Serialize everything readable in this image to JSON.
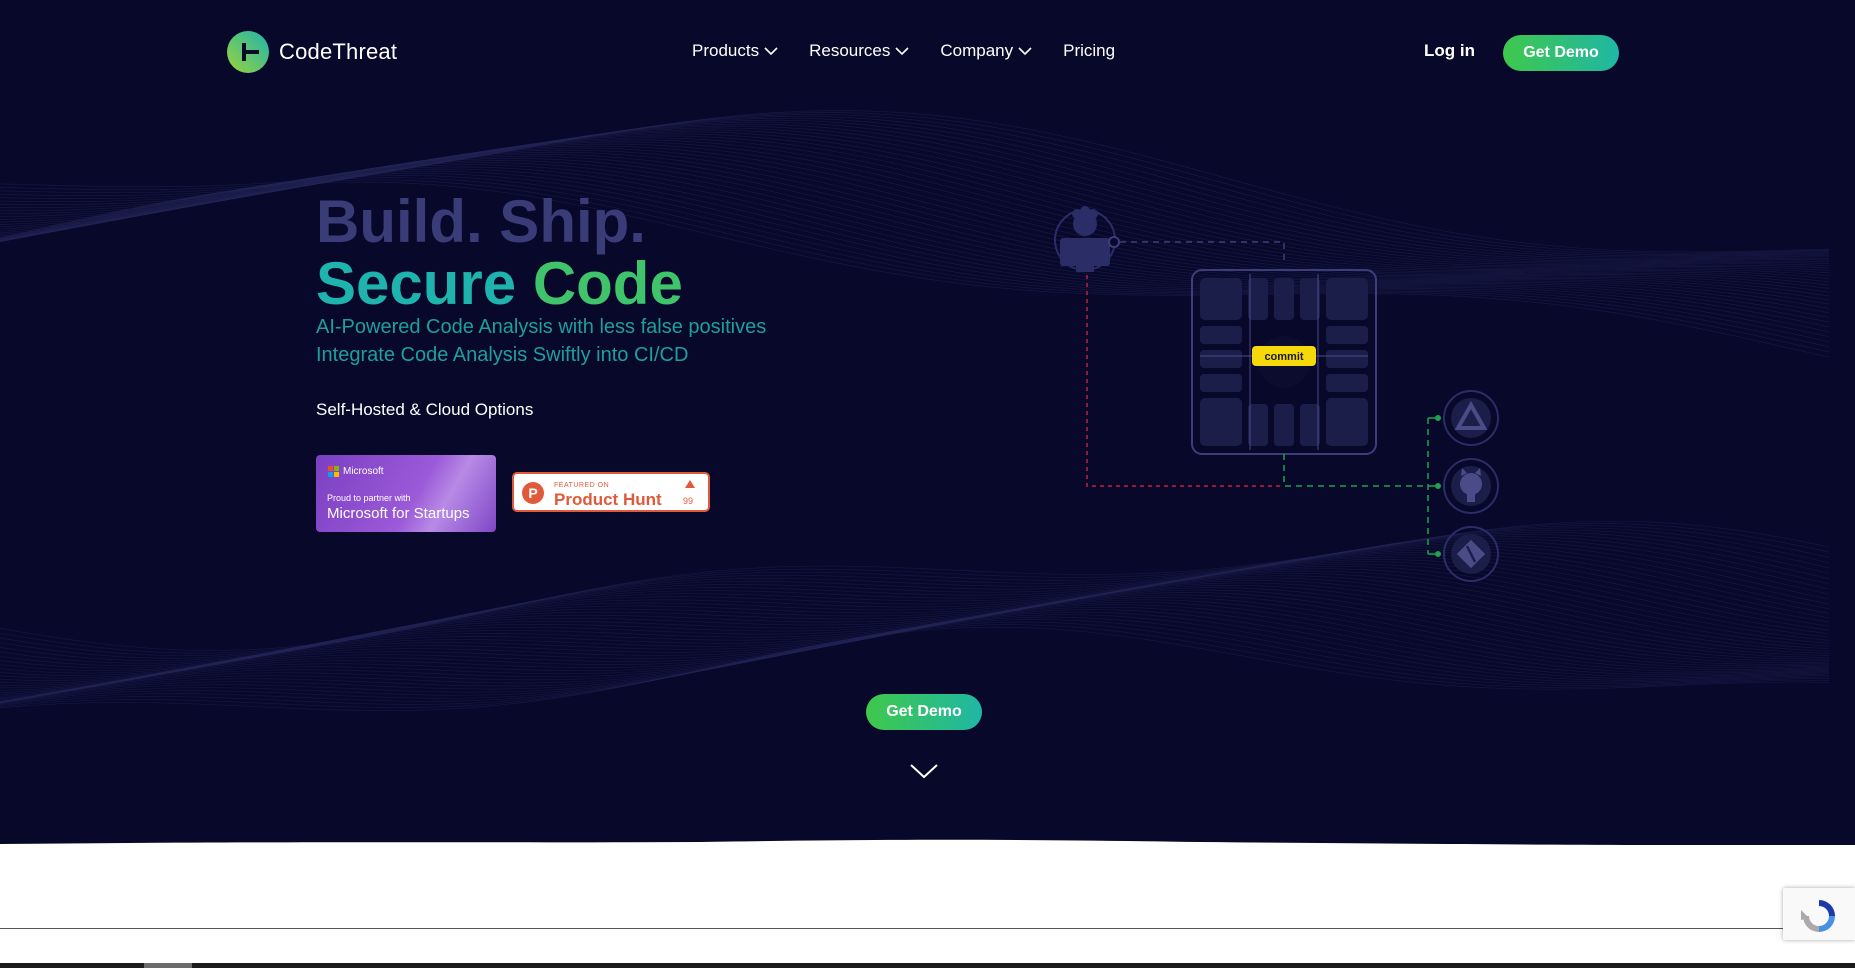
{
  "brand": {
    "name": "CodeThreat"
  },
  "nav": {
    "items": [
      {
        "label": "Products",
        "has_dropdown": true
      },
      {
        "label": "Resources",
        "has_dropdown": true
      },
      {
        "label": "Company",
        "has_dropdown": true
      },
      {
        "label": "Pricing",
        "has_dropdown": false
      }
    ],
    "login_label": "Log in",
    "demo_label": "Get Demo"
  },
  "hero": {
    "headline_line1": "Build. Ship.",
    "headline_line2_part1": "Secure",
    "headline_line2_part2": "Code",
    "subtitle_line1": "AI-Powered Code Analysis with less false positives",
    "subtitle_line2": "Integrate Code Analysis Swiftly into CI/CD",
    "options_text": "Self-Hosted & Cloud Options",
    "cta_label": "Get Demo"
  },
  "badges": {
    "microsoft": {
      "logo_text": "Microsoft",
      "line1": "Proud to partner with",
      "line2": "Microsoft for Startups"
    },
    "product_hunt": {
      "featured_text": "FEATURED ON",
      "name": "Product Hunt",
      "letter": "P",
      "count": "99"
    }
  },
  "diagram": {
    "commit_label": "commit",
    "integration_icons": [
      "azure-devops-icon",
      "github-icon",
      "git-icon"
    ]
  },
  "colors": {
    "background": "#07082a",
    "accent_green": "#3fc84c",
    "accent_teal": "#1fb7a4",
    "headline_muted": "#3a3c78",
    "commit_yellow": "#f5d90a",
    "product_hunt": "#e05a3a"
  }
}
